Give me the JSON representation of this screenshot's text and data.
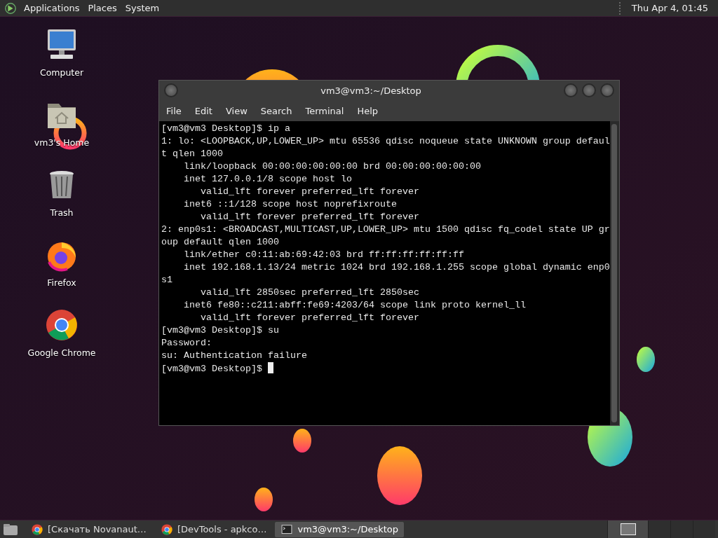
{
  "top_panel": {
    "menus": [
      "Applications",
      "Places",
      "System"
    ],
    "clock": "Thu Apr  4, 01:45"
  },
  "desktop_icons": [
    {
      "kind": "computer",
      "label": "Computer"
    },
    {
      "kind": "home",
      "label": "vm3's Home"
    },
    {
      "kind": "trash",
      "label": "Trash"
    },
    {
      "kind": "firefox",
      "label": "Firefox"
    },
    {
      "kind": "chrome",
      "label": "Google Chrome"
    }
  ],
  "terminal": {
    "title": "vm3@vm3:~/Desktop",
    "menu": [
      "File",
      "Edit",
      "View",
      "Search",
      "Terminal",
      "Help"
    ],
    "lines": [
      "[vm3@vm3 Desktop]$ ip a",
      "1: lo: <LOOPBACK,UP,LOWER_UP> mtu 65536 qdisc noqueue state UNKNOWN group defaul",
      "t qlen 1000",
      "    link/loopback 00:00:00:00:00:00 brd 00:00:00:00:00:00",
      "    inet 127.0.0.1/8 scope host lo",
      "       valid_lft forever preferred_lft forever",
      "    inet6 ::1/128 scope host noprefixroute",
      "       valid_lft forever preferred_lft forever",
      "2: enp0s1: <BROADCAST,MULTICAST,UP,LOWER_UP> mtu 1500 qdisc fq_codel state UP gr",
      "oup default qlen 1000",
      "    link/ether c0:11:ab:69:42:03 brd ff:ff:ff:ff:ff:ff",
      "    inet 192.168.1.13/24 metric 1024 brd 192.168.1.255 scope global dynamic enp0",
      "s1",
      "       valid_lft 2850sec preferred_lft 2850sec",
      "    inet6 fe80::c211:abff:fe69:4203/64 scope link proto kernel_ll",
      "       valid_lft forever preferred_lft forever",
      "[vm3@vm3 Desktop]$ su",
      "Password:",
      "su: Authentication failure",
      "[vm3@vm3 Desktop]$ "
    ],
    "cursor": true
  },
  "taskbar": {
    "tasks": [
      {
        "kind": "chrome",
        "label": "[Скачать Novanaut…",
        "selected": false
      },
      {
        "kind": "chrome",
        "label": "[DevTools - apkco…",
        "selected": false
      },
      {
        "kind": "terminal",
        "label": "vm3@vm3:~/Desktop",
        "selected": true
      }
    ],
    "workspaces": [
      {
        "selected": true
      },
      {
        "selected": false
      },
      {
        "selected": false
      },
      {
        "selected": false
      }
    ]
  }
}
